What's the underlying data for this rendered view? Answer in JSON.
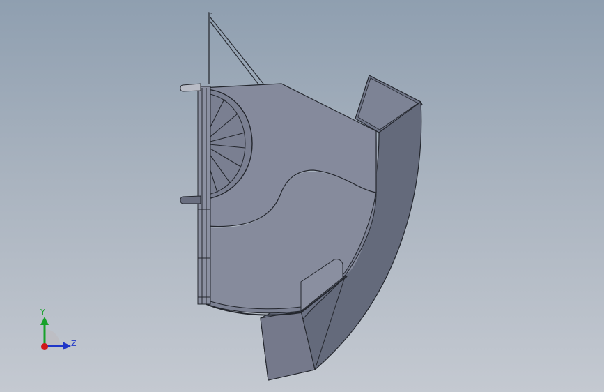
{
  "viewport": {
    "background_top": "#8f9fb0",
    "background_bottom": "#c4c9d1"
  },
  "model": {
    "face_color": "#7f8597",
    "face_light": "#8a90a2",
    "face_dark": "#626779",
    "edge_color": "#24272e"
  },
  "triad": {
    "y_label": "Y",
    "z_label": "Z",
    "y_color": "#17a12a",
    "z_color": "#1f36c8",
    "x_color": "#d01818"
  }
}
